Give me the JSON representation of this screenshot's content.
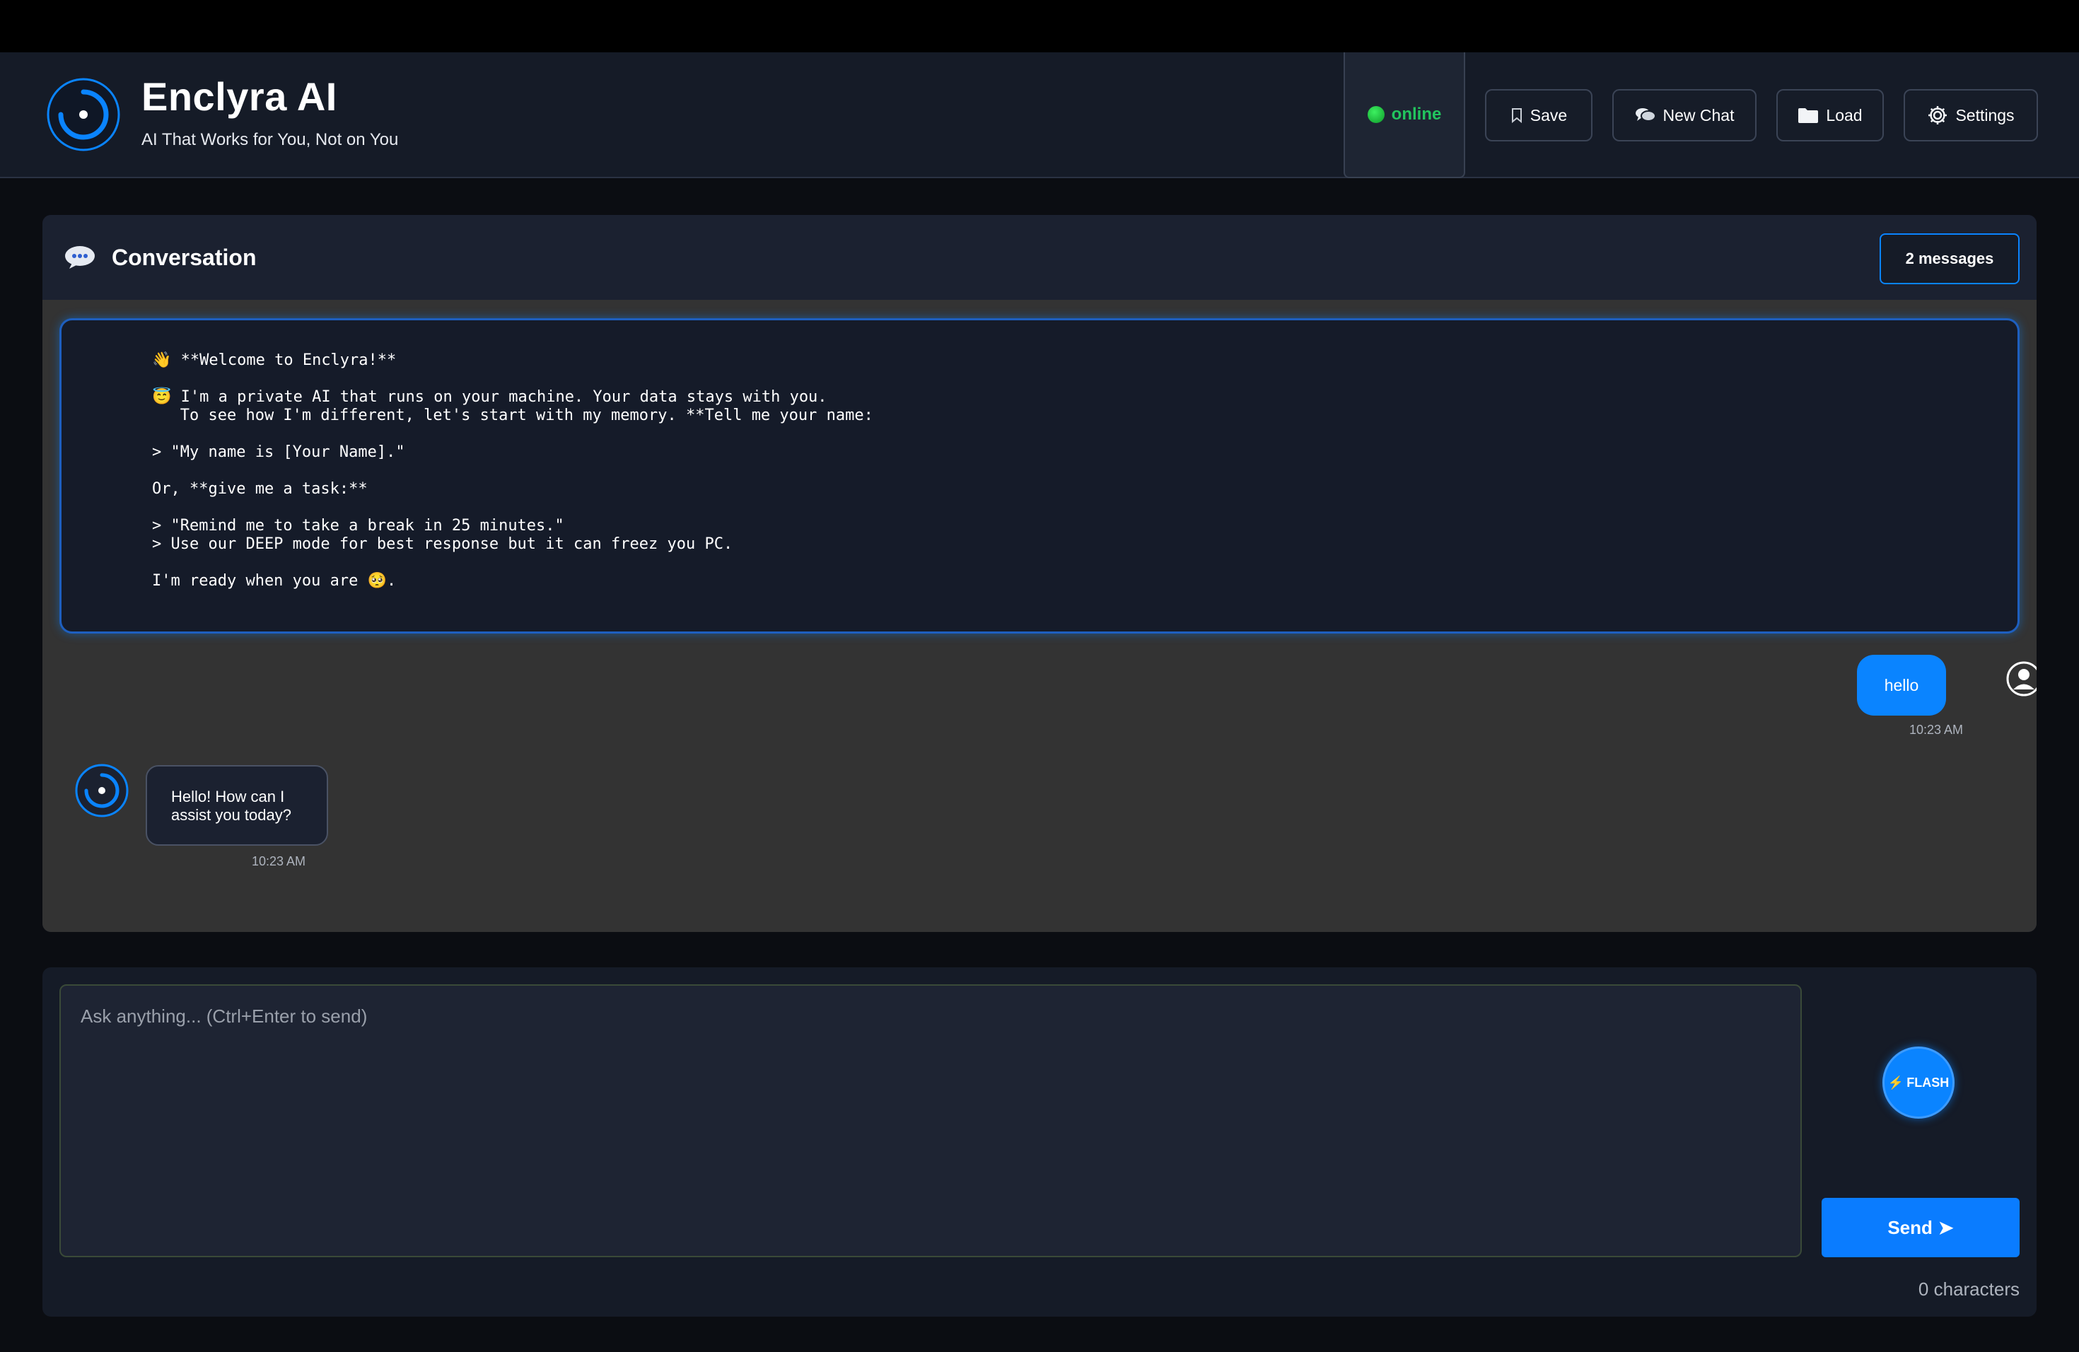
{
  "header": {
    "title": "Enclyra AI",
    "subtitle": "AI That Works for You, Not on You",
    "status": "online",
    "buttons": {
      "save": "Save",
      "new_chat": "New Chat",
      "load": "Load",
      "settings": "Settings"
    }
  },
  "conversation": {
    "title": "Conversation",
    "count_label": "2 messages",
    "welcome_text": "👋 **Welcome to Enclyra!**\n\n😇 I'm a private AI that runs on your machine. Your data stays with you.\n   To see how I'm different, let's start with my memory. **Tell me your name:\n\n> \"My name is [Your Name].\"\n\nOr, **give me a task:**\n\n> \"Remind me to take a break in 25 minutes.\"\n> Use our DEEP mode for best response but it can freez you PC.\n\nI'm ready when you are 🥺.",
    "messages": [
      {
        "role": "user",
        "text": "hello",
        "time": "10:23 AM"
      },
      {
        "role": "assistant",
        "text": "Hello! How can I assist you today?",
        "time": "10:23 AM"
      }
    ]
  },
  "composer": {
    "placeholder": "Ask anything... (Ctrl+Enter to send)",
    "value": "",
    "flash_label": "FLASH",
    "send_label": "Send",
    "char_count": "0 characters"
  },
  "colors": {
    "accent": "#0a84ff",
    "online": "#22c55e"
  },
  "icons": {
    "logo": "enclyra-logo-icon",
    "save": "bookmark-icon",
    "new_chat": "chat-bubbles-icon",
    "load": "folder-icon",
    "settings": "gear-icon",
    "conversation": "speech-bubble-icon",
    "user": "user-avatar-icon"
  }
}
